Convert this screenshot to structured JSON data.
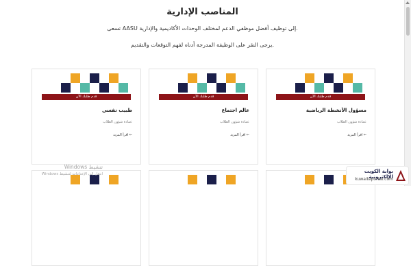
{
  "page": {
    "title": "المناصب الإدارية",
    "intro": ".إلى توظيف أفضل موظفي الدعم لمختلف الوحدات الأكاديمية والإدارية AASU تسعى",
    "instruction": ".يرجى النقر على الوظيفة المدرجة أدناه لفهم التوقعات والتقديم"
  },
  "cards": [
    {
      "band": "قدم طلبك الآن",
      "job": "مسؤول الأنشطة الرياضية",
      "dept": "عمادة شؤون الطلاب",
      "more": "← اقرأ المزيد"
    },
    {
      "band": "قدم طلبك الآن",
      "job": "عالم اجتماع",
      "dept": "عمادة شؤون الطلاب",
      "more": "← اقرأ المزيد"
    },
    {
      "band": "قدم طلبك الآن",
      "job": "طبيب نفسي",
      "dept": "عمادة شؤون الطلاب",
      "more": "← اقرأ المزيد"
    }
  ],
  "watermark": {
    "line1": "تنشيط Windows",
    "line2": "انتقل إلى الإعدادات لتنشيط Windows"
  },
  "logo": {
    "arabic": "بوابة الكويت الإلكترونية",
    "english": "kuwaiteportal.com"
  },
  "colors": {
    "navy": "#1b1f4a",
    "orange": "#efa525",
    "teal": "#55b9a6",
    "band_red": "#8d1418"
  }
}
